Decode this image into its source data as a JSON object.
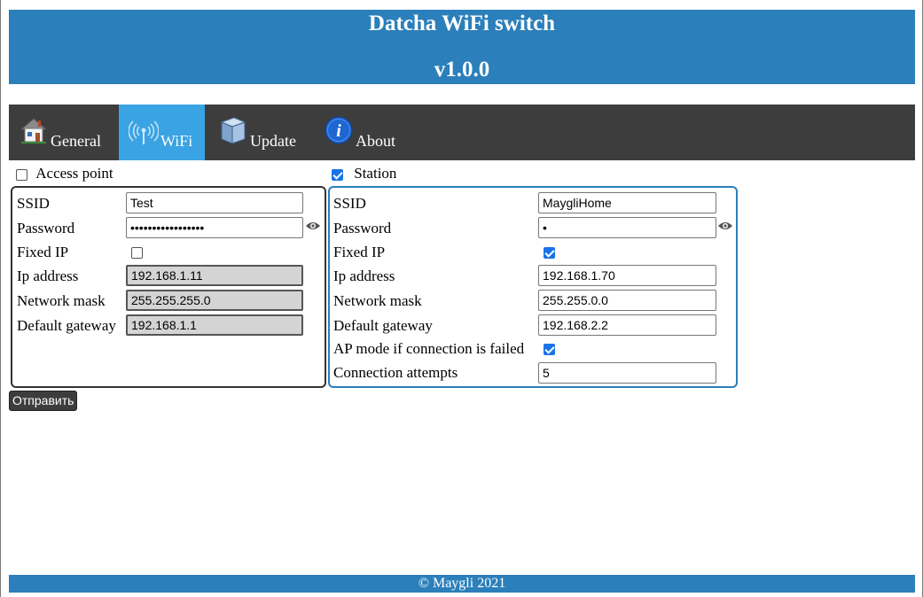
{
  "header": {
    "title": "Datcha WiFi switch",
    "version": "v1.0.0"
  },
  "tabs": [
    {
      "label": "General",
      "icon": "house-icon",
      "active": false
    },
    {
      "label": "WiFi",
      "icon": "wifi-antenna-icon",
      "active": true
    },
    {
      "label": "Update",
      "icon": "box-icon",
      "active": false
    },
    {
      "label": "About",
      "icon": "info-icon",
      "active": false
    }
  ],
  "access_point": {
    "enabled_label": "Access point",
    "enabled": false,
    "ssid_label": "SSID",
    "ssid": "Test",
    "password_label": "Password",
    "password": "•••••••••••••••••",
    "fixed_ip_label": "Fixed IP",
    "fixed_ip": false,
    "ip_label": "Ip address",
    "ip": "192.168.1.11",
    "mask_label": "Network mask",
    "mask": "255.255.255.0",
    "gateway_label": "Default gateway",
    "gateway": "192.168.1.1"
  },
  "station": {
    "enabled_label": "Station",
    "enabled": true,
    "ssid_label": "SSID",
    "ssid": "MaygliHome",
    "password_label": "Password",
    "password": "•",
    "fixed_ip_label": "Fixed IP",
    "fixed_ip": true,
    "ip_label": "Ip address",
    "ip": "192.168.1.70",
    "mask_label": "Network mask",
    "mask": "255.255.0.0",
    "gateway_label": "Default gateway",
    "gateway": "192.168.2.2",
    "ap_fallback_label": "AP mode if connection is failed",
    "ap_fallback": true,
    "attempts_label": "Connection attempts",
    "attempts": "5"
  },
  "submit_label": "Отправить",
  "footer": {
    "copyright": "© Maygli 2021"
  },
  "colors": {
    "header": "#2b7fba",
    "tabbar": "#3d3d3d",
    "active_tab": "#3aa3e3",
    "station_border": "#2b7fba"
  }
}
